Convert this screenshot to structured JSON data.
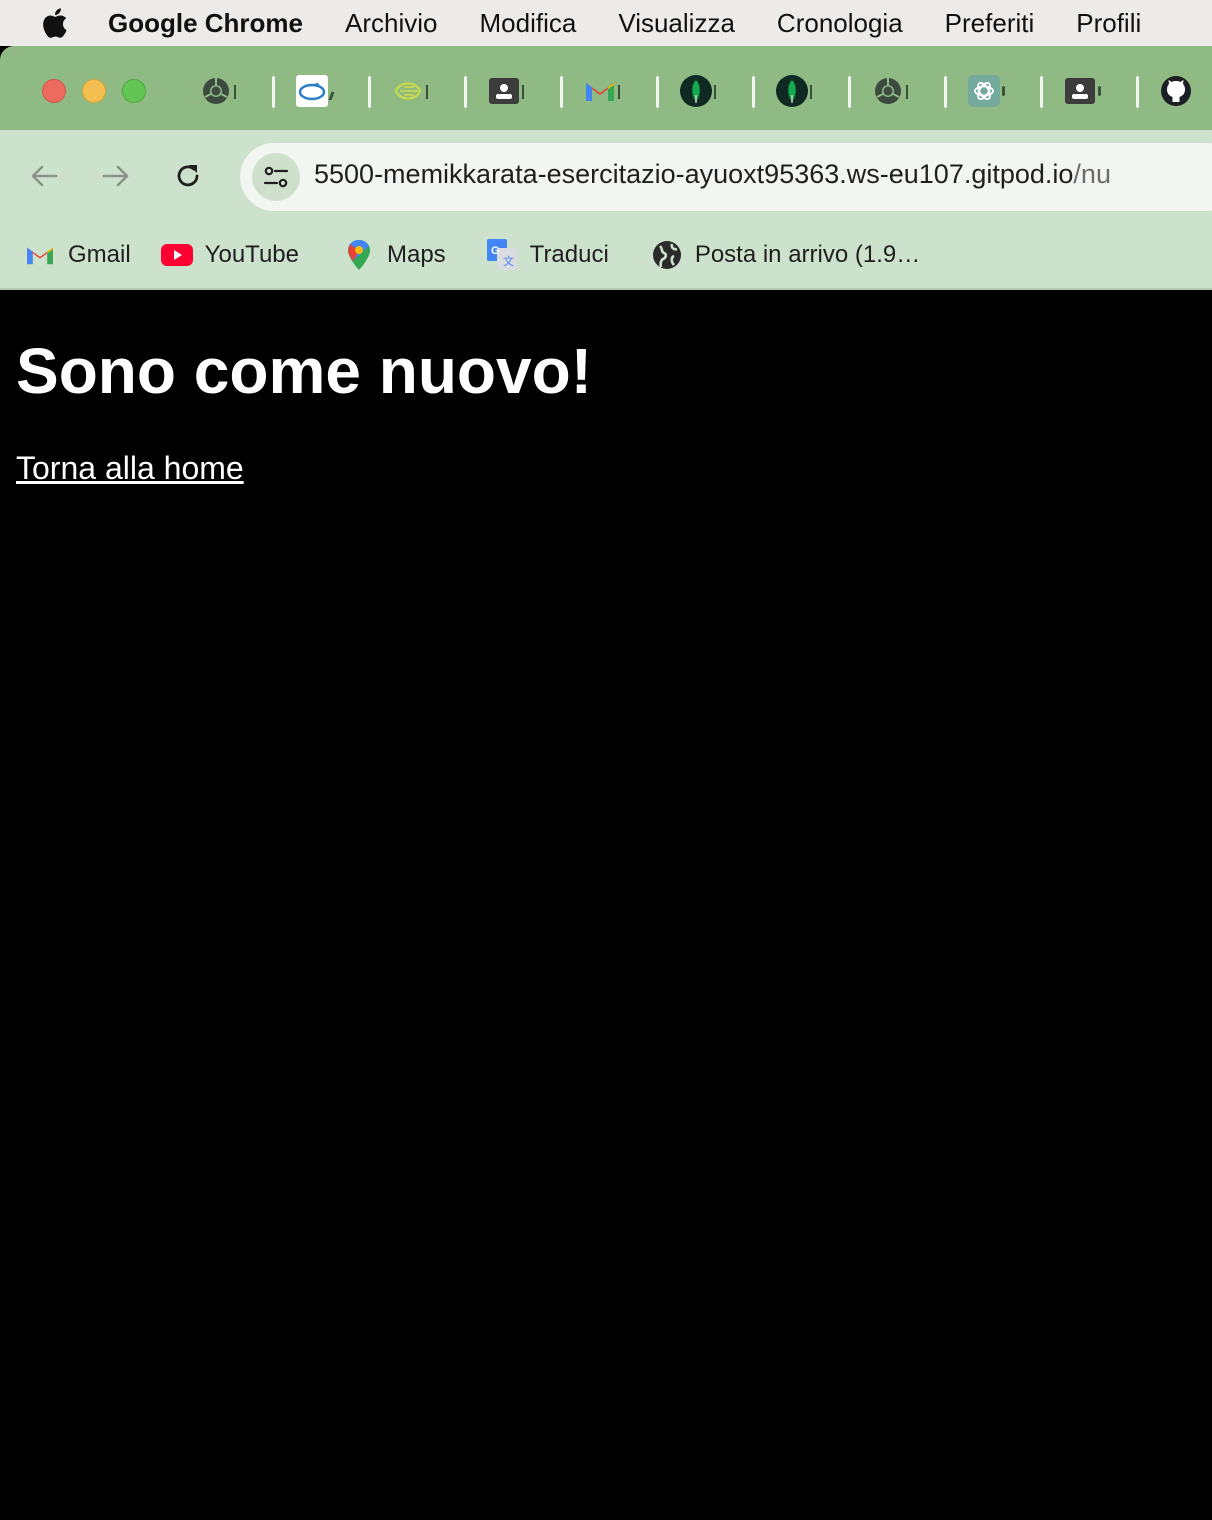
{
  "menubar": {
    "app_name": "Google Chrome",
    "items": [
      "Archivio",
      "Modifica",
      "Visualizza",
      "Cronologia",
      "Preferiti",
      "Profili"
    ]
  },
  "tabs": [
    {
      "icon": "chrome-icon"
    },
    {
      "icon": "doc-app-icon"
    },
    {
      "icon": "leaf-app-icon"
    },
    {
      "icon": "contact-card-icon"
    },
    {
      "icon": "gmail-icon"
    },
    {
      "icon": "mongodb-leaf-icon"
    },
    {
      "icon": "mongodb-leaf-icon"
    },
    {
      "icon": "chrome-icon"
    },
    {
      "icon": "openai-icon"
    },
    {
      "icon": "contact-card-icon"
    },
    {
      "icon": "github-icon"
    }
  ],
  "address_bar": {
    "host": "5500-memikkarata-esercitazio-ayuoxt95363.ws-eu107.gitpod.io",
    "path": "/nu"
  },
  "bookmarks": [
    {
      "label": "Gmail",
      "icon": "gmail-icon"
    },
    {
      "label": "YouTube",
      "icon": "youtube-icon"
    },
    {
      "label": "Maps",
      "icon": "maps-pin-icon"
    },
    {
      "label": "Traduci",
      "icon": "translate-icon"
    },
    {
      "label": "Posta in arrivo (1.9…",
      "icon": "globe-icon"
    }
  ],
  "page": {
    "heading": "Sono come nuovo!",
    "link": "Torna alla home"
  },
  "colors": {
    "tab_strip": "#8fba84",
    "toolbar": "#cde2cc",
    "page_background": "#000000",
    "page_text": "#ffffff"
  }
}
